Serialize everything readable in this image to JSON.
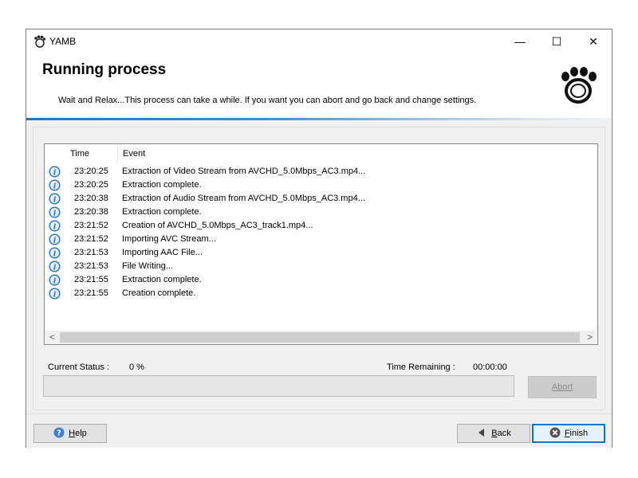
{
  "window": {
    "title": "YAMB",
    "controls": {
      "minimize": "—",
      "maximize": "☐",
      "close": "✕"
    }
  },
  "header": {
    "title": "Running process",
    "subtitle": "Wait and Relax...This process can take a while. If you want you can abort and go back and change settings."
  },
  "log": {
    "columns": {
      "time": "Time",
      "event": "Event"
    },
    "rows": [
      {
        "time": "23:20:25",
        "event": "Extraction of Video Stream from AVCHD_5.0Mbps_AC3.mp4..."
      },
      {
        "time": "23:20:25",
        "event": "Extraction complete."
      },
      {
        "time": "23:20:38",
        "event": "Extraction of Audio Stream from AVCHD_5.0Mbps_AC3.mp4..."
      },
      {
        "time": "23:20:38",
        "event": "Extraction complete."
      },
      {
        "time": "23:21:52",
        "event": "Creation of AVCHD_5.0Mbps_AC3_track1.mp4..."
      },
      {
        "time": "23:21:52",
        "event": "Importing AVC Stream..."
      },
      {
        "time": "23:21:53",
        "event": "Importing AAC File..."
      },
      {
        "time": "23:21:53",
        "event": "File Writing..."
      },
      {
        "time": "23:21:55",
        "event": "Extraction complete."
      },
      {
        "time": "23:21:55",
        "event": "Creation complete."
      }
    ],
    "scroll_left": "<",
    "scroll_right": ">"
  },
  "status": {
    "current_label": "Current Status :",
    "current_value": "0 %",
    "time_remaining_label": "Time Remaining :",
    "time_remaining_value": "00:00:00",
    "progress_fraction": 0
  },
  "buttons": {
    "abort": "Abort",
    "help": {
      "accel": "H",
      "rest": "elp"
    },
    "back": {
      "accel": "B",
      "rest": "ack"
    },
    "finish": {
      "accel": "F",
      "rest": "inish"
    }
  },
  "icons": {
    "row_icon": "info-icon",
    "app_icon": "yamb-footprint-icon",
    "logo": "yamb-footprint-logo"
  },
  "colors": {
    "accent": "#0078d7",
    "info_blue": "#1e6fcf",
    "progress_green": "#06b025"
  }
}
